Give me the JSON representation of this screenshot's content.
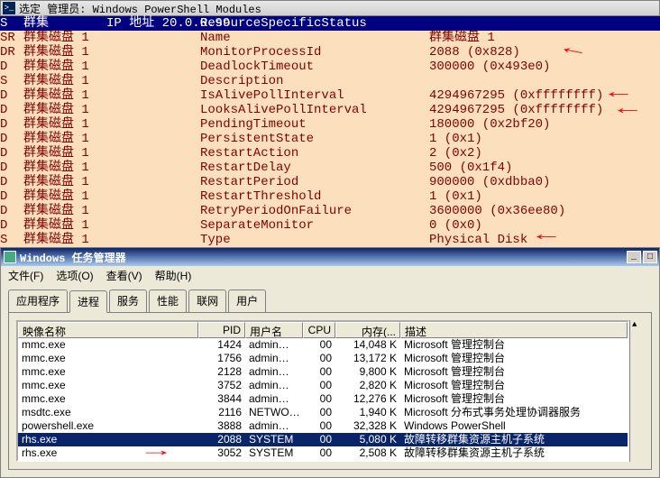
{
  "ps": {
    "title": "选定 管理员: Windows PowerShell Modules",
    "header": {
      "c0": "S",
      "c1": "群集",
      "c2": "IP 地址",
      "ip": "20.0.0.99",
      "status_label": "ResourceSpecificStatus"
    },
    "rows": [
      {
        "c0": "SR",
        "c1": "群集磁盘 1",
        "c3": "Name",
        "c4": "群集磁盘 1"
      },
      {
        "c0": "DR",
        "c1": "群集磁盘 1",
        "c3": "MonitorProcessId",
        "c4": "2088 (0x828)"
      },
      {
        "c0": "D",
        "c1": "群集磁盘 1",
        "c3": "DeadlockTimeout",
        "c4": "300000 (0x493e0)"
      },
      {
        "c0": "S",
        "c1": "群集磁盘 1",
        "c3": "Description",
        "c4": ""
      },
      {
        "c0": "D",
        "c1": "群集磁盘 1",
        "c3": "IsAlivePollInterval",
        "c4": "4294967295 (0xffffffff)"
      },
      {
        "c0": "D",
        "c1": "群集磁盘 1",
        "c3": "LooksAlivePollInterval",
        "c4": "4294967295 (0xffffffff)"
      },
      {
        "c0": "D",
        "c1": "群集磁盘 1",
        "c3": "PendingTimeout",
        "c4": "180000 (0x2bf20)"
      },
      {
        "c0": "D",
        "c1": "群集磁盘 1",
        "c3": "PersistentState",
        "c4": "1 (0x1)"
      },
      {
        "c0": "D",
        "c1": "群集磁盘 1",
        "c3": "RestartAction",
        "c4": "2 (0x2)"
      },
      {
        "c0": "D",
        "c1": "群集磁盘 1",
        "c3": "RestartDelay",
        "c4": "500 (0x1f4)"
      },
      {
        "c0": "D",
        "c1": "群集磁盘 1",
        "c3": "RestartPeriod",
        "c4": "900000 (0xdbba0)"
      },
      {
        "c0": "D",
        "c1": "群集磁盘 1",
        "c3": "RestartThreshold",
        "c4": "1 (0x1)"
      },
      {
        "c0": "D",
        "c1": "群集磁盘 1",
        "c3": "RetryPeriodOnFailure",
        "c4": "3600000 (0x36ee80)"
      },
      {
        "c0": "D",
        "c1": "群集磁盘 1",
        "c3": "SeparateMonitor",
        "c4": "0 (0x0)"
      },
      {
        "c0": "S",
        "c1": "群集磁盘 1",
        "c3": "Type",
        "c4": "Physical Disk"
      }
    ]
  },
  "tm": {
    "title": "Windows 任务管理器",
    "menu": [
      "文件(F)",
      "选项(O)",
      "查看(V)",
      "帮助(H)"
    ],
    "tabs": [
      "应用程序",
      "进程",
      "服务",
      "性能",
      "联网",
      "用户"
    ],
    "active_tab": 1,
    "columns": [
      "映像名称",
      "PID",
      "用户名",
      "CPU",
      "内存(...",
      "描述"
    ],
    "procs": [
      {
        "name": "mmc.exe",
        "pid": "1424",
        "user": "admin…",
        "cpu": "00",
        "mem": "14,048 K",
        "desc": "Microsoft 管理控制台"
      },
      {
        "name": "mmc.exe",
        "pid": "1756",
        "user": "admin…",
        "cpu": "00",
        "mem": "13,172 K",
        "desc": "Microsoft 管理控制台"
      },
      {
        "name": "mmc.exe",
        "pid": "2128",
        "user": "admin…",
        "cpu": "00",
        "mem": "9,800 K",
        "desc": "Microsoft 管理控制台"
      },
      {
        "name": "mmc.exe",
        "pid": "3752",
        "user": "admin…",
        "cpu": "00",
        "mem": "2,820 K",
        "desc": "Microsoft 管理控制台"
      },
      {
        "name": "mmc.exe",
        "pid": "3844",
        "user": "admin…",
        "cpu": "00",
        "mem": "12,276 K",
        "desc": "Microsoft 管理控制台"
      },
      {
        "name": "msdtc.exe",
        "pid": "2116",
        "user": "NETWO…",
        "cpu": "00",
        "mem": "1,940 K",
        "desc": "Microsoft 分布式事务处理协调器服务"
      },
      {
        "name": "powershell.exe",
        "pid": "3888",
        "user": "admin…",
        "cpu": "00",
        "mem": "32,328 K",
        "desc": "Windows PowerShell"
      },
      {
        "name": "rhs.exe",
        "pid": "2088",
        "user": "SYSTEM",
        "cpu": "00",
        "mem": "5,080 K",
        "desc": "故障转移群集资源主机子系统",
        "sel": true
      },
      {
        "name": "rhs.exe",
        "pid": "3052",
        "user": "SYSTEM",
        "cpu": "00",
        "mem": "2,508 K",
        "desc": "故障转移群集资源主机子系统"
      }
    ]
  }
}
